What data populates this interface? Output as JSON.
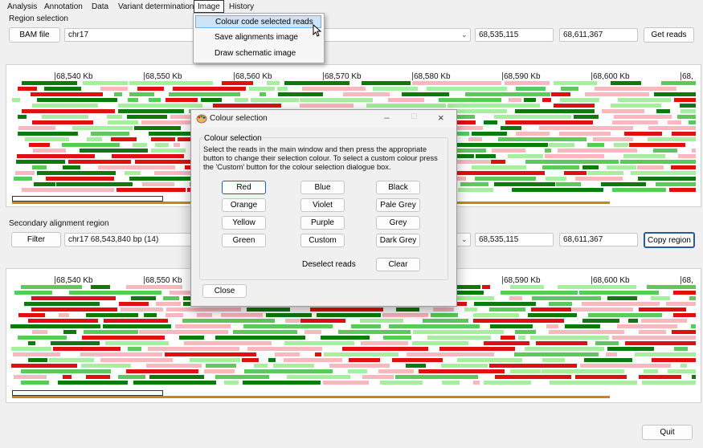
{
  "menu": {
    "analysis": "Analysis",
    "annotation": "Annotation",
    "data": "Data",
    "variant": "Variant determination",
    "image": "Image",
    "history": "History"
  },
  "image_menu": {
    "item1": "Colour code selected reads",
    "item2": "Save alignments image",
    "item3": "Draw schematic image"
  },
  "region": {
    "label": "Region selection",
    "bam_button": "BAM file",
    "chrom": "chr17",
    "start": "68,535,115",
    "end": "68,611,367",
    "get_reads": "Get reads"
  },
  "ticks": [
    "68,540 Kb",
    "68,550 Kb",
    "68,560 Kb",
    "68,570 Kb",
    "68,580 Kb",
    "68,590 Kb",
    "68,600 Kb",
    "68,"
  ],
  "secondary": {
    "label": "Secondary alignment region",
    "filter": "Filter",
    "region_text": "chr17 68,543,840 bp (14)",
    "start": "68,535,115",
    "end": "68,611,367",
    "copy_region": "Copy region"
  },
  "dialog": {
    "title": "Colour selection",
    "group_label": "Colour selection",
    "instructions": "Select the reads in the main window and then press the appropriate button to change their selection colour. To select a custom colour press the 'Custom' button for the colour selection dialogue box.",
    "buttons": {
      "red": "Red",
      "blue": "Blue",
      "black": "Black",
      "orange": "Orange",
      "violet": "Violet",
      "pale_grey": "Pale Grey",
      "yellow": "Yellow",
      "purple": "Purple",
      "grey": "Grey",
      "green": "Green",
      "custom": "Custom",
      "dark_grey": "Dark Grey"
    },
    "deselect_label": "Deselect reads",
    "clear": "Clear",
    "close": "Close"
  },
  "quit": "Quit",
  "read_colors": {
    "dark_green": "#0e7a0e",
    "green": "#5cc95c",
    "light_green": "#a8eea0",
    "red": "#e01010",
    "pink": "#f7b8be"
  }
}
